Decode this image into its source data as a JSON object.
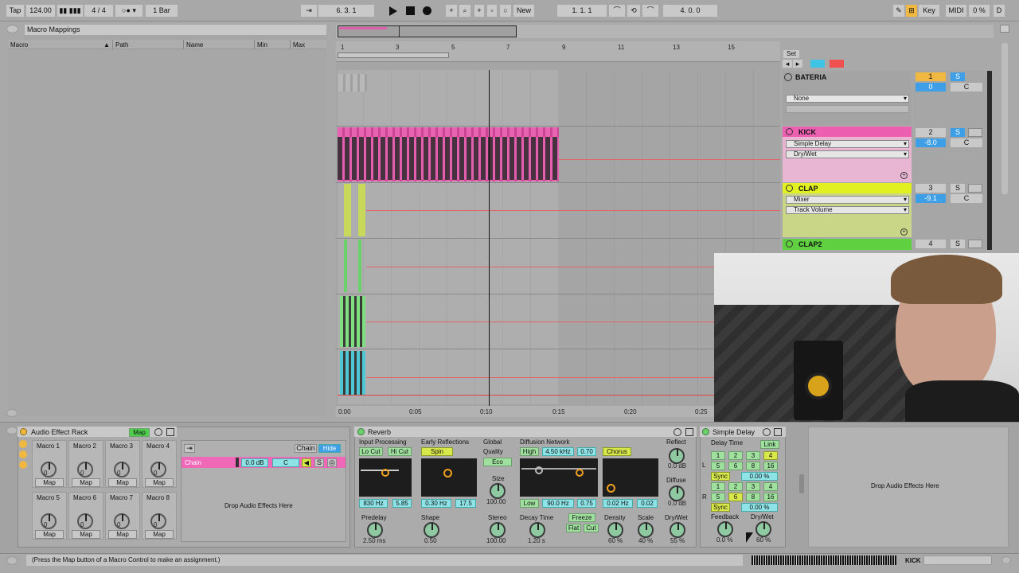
{
  "transport": {
    "tap": "Tap",
    "tempo": "124.00",
    "signature": "4 / 4",
    "quantize": "1 Bar",
    "position": "6.  3.  1",
    "new": "New",
    "loop_start": "1.  1.  1",
    "loop_length": "4.  0.  0",
    "key": "Key",
    "midi": "MIDI",
    "cpu": "0 %",
    "d": "D"
  },
  "left_panel": {
    "title": "Macro Mappings",
    "columns": [
      "Macro",
      "Path",
      "Name",
      "Min",
      "Max"
    ]
  },
  "ruler": {
    "bars": [
      "1",
      "3",
      "5",
      "7",
      "9",
      "11",
      "13",
      "15"
    ],
    "time": [
      "0:00",
      "0:05",
      "0:10",
      "0:15",
      "0:20",
      "0:25"
    ]
  },
  "mixer": {
    "set_label": "Set",
    "tracks": [
      {
        "name": "BATERIA",
        "num": "1",
        "s": "S",
        "vol": "0",
        "pan": "C",
        "dev1": "None",
        "dev2": ""
      },
      {
        "name": "KICK",
        "num": "2",
        "s": "S",
        "vol": "-8.0",
        "pan": "C",
        "dev1": "Simple Delay",
        "dev2": "Dry/Wet"
      },
      {
        "name": "CLAP",
        "num": "3",
        "s": "S",
        "vol": "-9.1",
        "pan": "C",
        "dev1": "Mixer",
        "dev2": "Track Volume"
      },
      {
        "name": "CLAP2",
        "num": "4",
        "s": "S",
        "vol": "",
        "pan": "",
        "dev1": "",
        "dev2": ""
      }
    ]
  },
  "rack": {
    "title": "Audio Effect Rack",
    "map": "Map",
    "macros": [
      "Macro 1",
      "Macro 2",
      "Macro 3",
      "Macro 4",
      "Macro 5",
      "Macro 6",
      "Macro 7",
      "Macro 8"
    ],
    "macro_value": "0",
    "chain_btn": "Chain",
    "hide_btn": "Hide",
    "chain_name": "Chain",
    "chain_vol": "0.0 dB",
    "chain_pan": "C",
    "chain_s": "S",
    "drop": "Drop Audio Effects Here"
  },
  "reverb": {
    "title": "Reverb",
    "input": "Input Processing",
    "lo": "Lo Cut",
    "hi": "Hi Cut",
    "in_freq": "830 Hz",
    "in_q": "5.85",
    "early": "Early Reflections",
    "spin": "Spin",
    "er_freq": "0.30 Hz",
    "er_amt": "17.5",
    "global": "Global",
    "quality": "Quality",
    "eco": "Eco",
    "size_lbl": "Size",
    "size": "100.00",
    "diffusion": "Diffusion Network",
    "high": "High",
    "high_freq": "4.50 kHz",
    "high_val": "0.70",
    "chorus": "Chorus",
    "low": "Low",
    "low_freq": "90.0 Hz",
    "low_val": "0.75",
    "ch_rate": "0.02 Hz",
    "ch_amt": "0.02",
    "reflect": "Reflect",
    "reflect_val": "0.0 dB",
    "diffuse": "Diffuse",
    "diffuse_val": "0.0 dB",
    "predelay": "Predelay",
    "predelay_val": "2.50 ms",
    "shape": "Shape",
    "shape_val": "0.50",
    "stereo": "Stereo",
    "stereo_val": "100.00",
    "decay": "Decay Time",
    "decay_val": "1.20 s",
    "freeze": "Freeze",
    "flat": "Flat",
    "cut": "Cut",
    "density": "Density",
    "density_val": "60 %",
    "scale": "Scale",
    "scale_val": "40 %",
    "drywet": "Dry/Wet",
    "drywet_val": "55 %"
  },
  "delay": {
    "title": "Simple Delay",
    "delay_time": "Delay Time",
    "link": "Link",
    "l": "L",
    "r": "R",
    "row1": [
      "1",
      "2",
      "3",
      "4"
    ],
    "row2": [
      "5",
      "6",
      "8",
      "16"
    ],
    "sync": "Sync",
    "offset": "0.00 %",
    "feedback": "Feedback",
    "feedback_val": "0.0 %",
    "drywet": "Dry/Wet",
    "drywet_val": "60 %"
  },
  "drop2": "Drop Audio Effects Here",
  "status": {
    "message": "(Press the Map button of a Macro Control to make an assignment.)",
    "track": "KICK"
  }
}
